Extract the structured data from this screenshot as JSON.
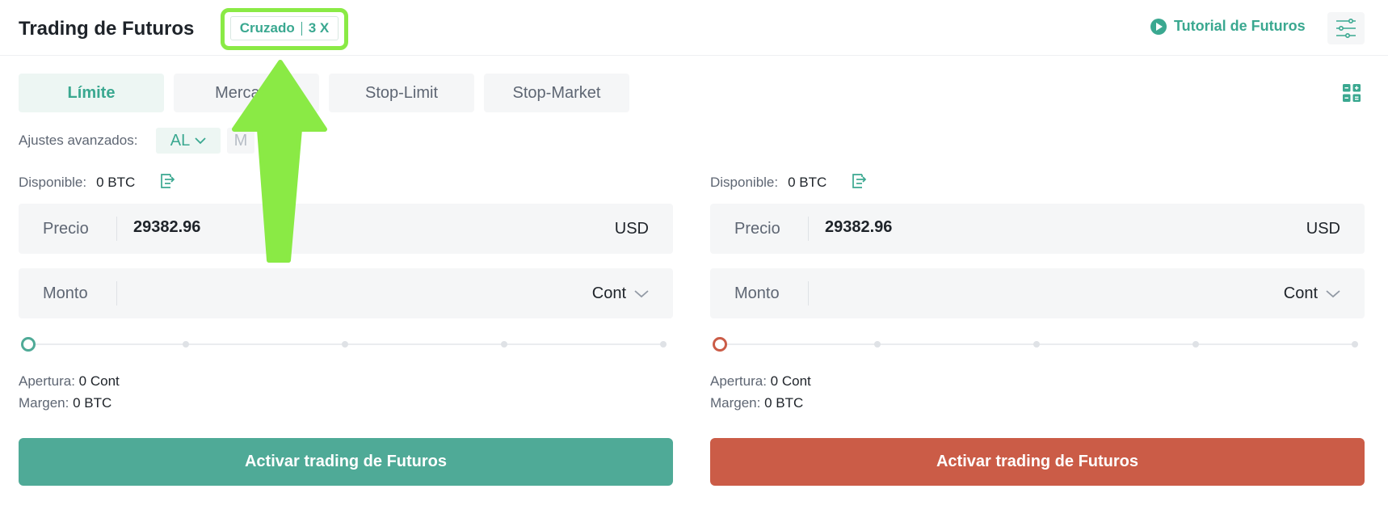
{
  "header": {
    "title": "Trading de Futuros",
    "margin_mode": "Cruzado",
    "leverage": "3 X",
    "tutorial_label": "Tutorial de Futuros"
  },
  "order_types": [
    {
      "label": "Límite",
      "active": true
    },
    {
      "label": "Mercado",
      "active": false
    },
    {
      "label": "Stop-Limit",
      "active": false
    },
    {
      "label": "Stop-Market",
      "active": false
    }
  ],
  "advanced": {
    "label": "Ajustes avanzados:",
    "al_label": "AL",
    "m_label": "M"
  },
  "buy": {
    "available_label": "Disponible:",
    "available_value": "0 BTC",
    "price_label": "Precio",
    "price_value": "29382.96",
    "price_unit": "USD",
    "amount_label": "Monto",
    "amount_unit": "Cont",
    "opening_label": "Apertura:",
    "opening_value": "0 Cont",
    "margin_label": "Margen:",
    "margin_value": "0 BTC",
    "button_label": "Activar trading de Futuros",
    "slider_percent": 0
  },
  "sell": {
    "available_label": "Disponible:",
    "available_value": "0 BTC",
    "price_label": "Precio",
    "price_value": "29382.96",
    "price_unit": "USD",
    "amount_label": "Monto",
    "amount_unit": "Cont",
    "opening_label": "Apertura:",
    "opening_value": "0 Cont",
    "margin_label": "Margen:",
    "margin_value": "0 BTC",
    "button_label": "Activar trading de Futuros",
    "slider_percent": 0
  },
  "colors": {
    "accent": "#3aa890",
    "buy": "#4faa97",
    "sell": "#cb5c47",
    "annotation": "#8aea45"
  },
  "icons": {
    "tutorial": "play-circle-icon",
    "settings": "sliders-icon",
    "layout": "grid-icon",
    "wallet": "transfer-icon",
    "dropdown": "chevron-down-icon",
    "annotation": "arrow-up-icon"
  }
}
